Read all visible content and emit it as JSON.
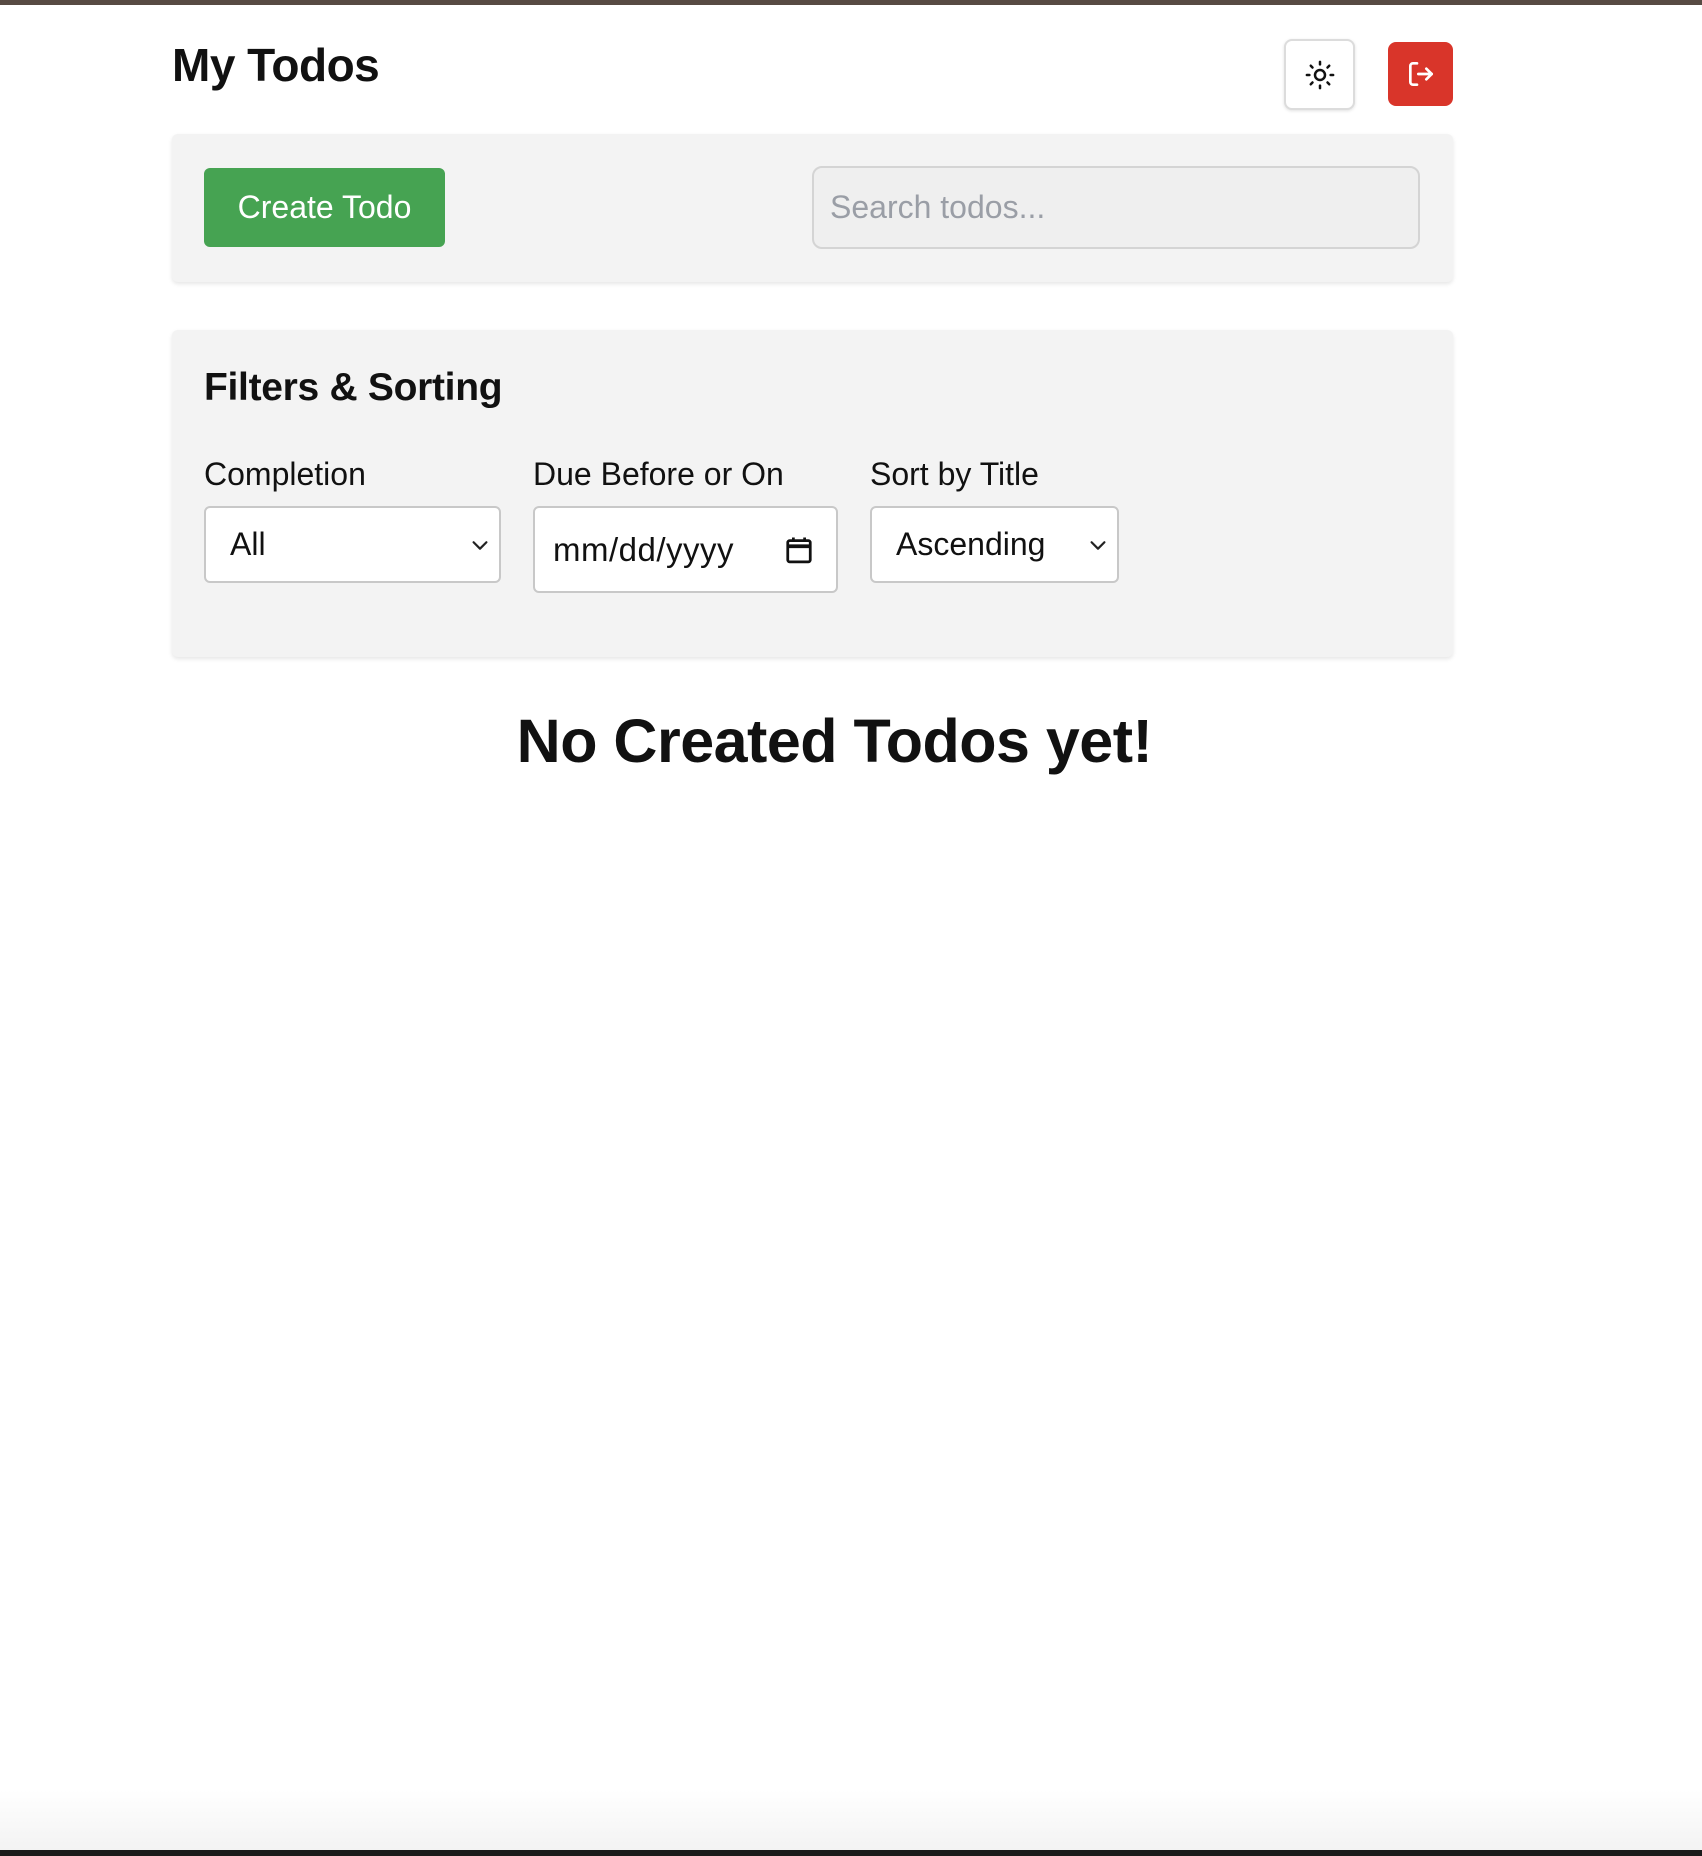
{
  "header": {
    "title": "My Todos",
    "theme_icon": "sun-icon",
    "logout_icon": "logout-icon"
  },
  "toolbar": {
    "create_label": "Create Todo",
    "search_placeholder": "Search todos...",
    "search_value": ""
  },
  "filters": {
    "title": "Filters & Sorting",
    "completion": {
      "label": "Completion",
      "value": "All"
    },
    "due": {
      "label": "Due Before or On",
      "placeholder": "mm/dd/yyyy",
      "icon": "calendar-icon"
    },
    "sort": {
      "label": "Sort by Title",
      "value": "Ascending"
    }
  },
  "empty_state": {
    "message": "No Created Todos yet!"
  },
  "colors": {
    "create_button": "#46a352",
    "logout_button": "#d9352a",
    "panel_background": "#f3f3f3"
  }
}
